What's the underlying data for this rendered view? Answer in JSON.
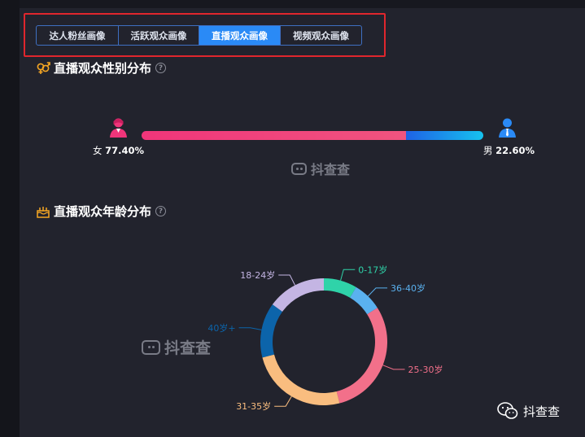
{
  "tabs": [
    {
      "label": "达人粉丝画像",
      "active": false
    },
    {
      "label": "活跃观众画像",
      "active": false
    },
    {
      "label": "直播观众画像",
      "active": true
    },
    {
      "label": "视频观众画像",
      "active": false
    }
  ],
  "gender_section": {
    "title": "直播观众性别分布",
    "female_label": "女",
    "female_percent": "77.40%",
    "male_label": "男",
    "male_percent": "22.60%",
    "female_share": 77.4,
    "male_share": 22.6,
    "female_color": "#f0357a",
    "male_color": "#2a8af6"
  },
  "age_section": {
    "title": "直播观众年龄分布"
  },
  "watermark": "抖查查",
  "wechat_label": "抖查查",
  "chart_data": {
    "type": "pie",
    "donut": true,
    "slices": [
      {
        "label": "0-17岁",
        "value": 8.5,
        "color": "#2fd3a9"
      },
      {
        "label": "36-40岁",
        "value": 7.5,
        "color": "#5ab1ef"
      },
      {
        "label": "25-30岁",
        "value": 30,
        "color": "#f2708a"
      },
      {
        "label": "31-35岁",
        "value": 25,
        "color": "#f9bd7f"
      },
      {
        "label": "40岁+",
        "value": 14,
        "color": "#0c64aa"
      },
      {
        "label": "18-24岁",
        "value": 15,
        "color": "#c4b5e3"
      }
    ]
  }
}
